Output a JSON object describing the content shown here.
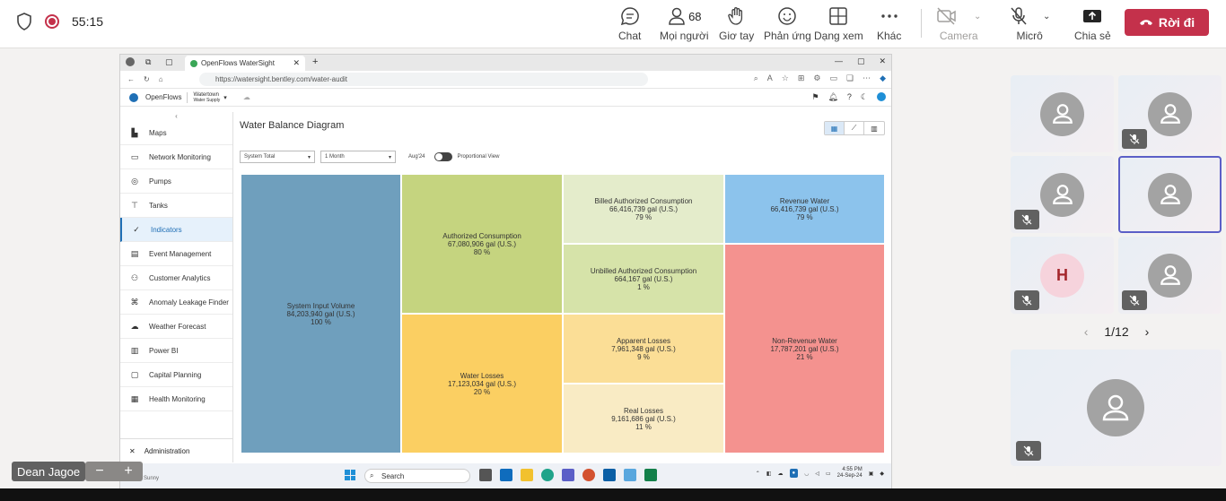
{
  "teams": {
    "timer": "55:15",
    "buttons": [
      {
        "label": "Chat",
        "icon": "chat-icon"
      },
      {
        "label": "Mọi người",
        "icon": "people-icon",
        "count": "68"
      },
      {
        "label": "Giơ tay",
        "icon": "raise-hand-icon"
      },
      {
        "label": "Phản ứng",
        "icon": "reaction-icon"
      },
      {
        "label": "Dạng xem",
        "icon": "view-icon"
      },
      {
        "label": "Khác",
        "icon": "more-icon"
      },
      {
        "label": "Camera",
        "icon": "camera-off-icon"
      },
      {
        "label": "Micrô",
        "icon": "mic-off-icon"
      },
      {
        "label": "Chia sẻ",
        "icon": "share-icon"
      }
    ],
    "leave_label": "Rời đi",
    "accent": "#c4314b",
    "pager": "1/12",
    "name_tag": "Dean Jagoe",
    "tile_letter": "H"
  },
  "browser": {
    "tab_title": "OpenFlows WaterSight",
    "url": "https://watersight.bentley.com/water-audit",
    "app_name": "OpenFlows",
    "org_name": "Watertown",
    "org_sub": "Water Supply",
    "sidebar": [
      {
        "label": "Maps",
        "icon": "map-icon"
      },
      {
        "label": "Network Monitoring",
        "icon": "monitor-icon"
      },
      {
        "label": "Pumps",
        "icon": "pump-icon"
      },
      {
        "label": "Tanks",
        "icon": "tank-icon"
      },
      {
        "label": "Indicators",
        "icon": "indicator-icon",
        "active": true
      },
      {
        "label": "Event Management",
        "icon": "event-icon"
      },
      {
        "label": "Customer Analytics",
        "icon": "customer-icon"
      },
      {
        "label": "Anomaly Leakage Finder",
        "icon": "anomaly-icon"
      },
      {
        "label": "Weather Forecast",
        "icon": "cloud-icon"
      },
      {
        "label": "Power BI",
        "icon": "powerbi-icon"
      },
      {
        "label": "Capital Planning",
        "icon": "planning-icon"
      },
      {
        "label": "Health Monitoring",
        "icon": "health-icon"
      }
    ],
    "admin_label": "Administration",
    "content_title": "Water Balance Diagram",
    "filter_system": "System Total",
    "filter_period": "1 Month",
    "filter_date": "Aug'24",
    "proportional_label": "Proportional View",
    "taskbar_search": "Search",
    "taskbar_time": "4:55 PM",
    "taskbar_date": "24-Sep-24",
    "weather": "Sunny"
  },
  "balance": {
    "system_input": {
      "label": "System Input Volume",
      "value": "84,203,940 gal (U.S.)",
      "pct": "100 %"
    },
    "authorized": {
      "label": "Authorized Consumption",
      "value": "67,080,906 gal (U.S.)",
      "pct": "80 %"
    },
    "water_losses": {
      "label": "Water Losses",
      "value": "17,123,034 gal (U.S.)",
      "pct": "20 %"
    },
    "billed": {
      "label": "Billed Authorized Consumption",
      "value": "66,416,739 gal (U.S.)",
      "pct": "79 %"
    },
    "unbilled": {
      "label": "Unbilled Authorized Consumption",
      "value": "664,167 gal (U.S.)",
      "pct": "1 %"
    },
    "apparent": {
      "label": "Apparent Losses",
      "value": "7,961,348 gal (U.S.)",
      "pct": "9 %"
    },
    "real": {
      "label": "Real Losses",
      "value": "9,161,686 gal (U.S.)",
      "pct": "11 %"
    },
    "revenue": {
      "label": "Revenue Water",
      "value": "66,416,739 gal (U.S.)",
      "pct": "79 %"
    },
    "nonrevenue": {
      "label": "Non-Revenue Water",
      "value": "17,787,201 gal (U.S.)",
      "pct": "21 %"
    },
    "colors": {
      "system_input": "#6f9fbd",
      "authorized": "#c5d47f",
      "water_losses": "#fbcf62",
      "billed": "#e4eccb",
      "unbilled": "#d6e3a9",
      "apparent": "#fbde96",
      "real": "#f9ebc4",
      "revenue": "#8cc3ec",
      "nonrevenue": "#f4928f"
    }
  }
}
